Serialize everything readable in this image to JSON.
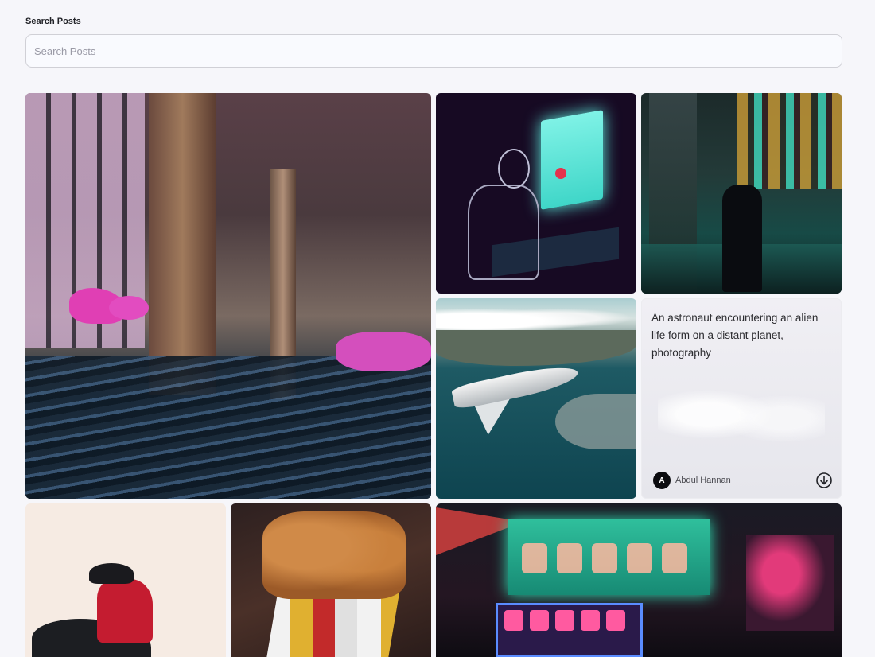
{
  "search": {
    "label": "Search Posts",
    "placeholder": "Search Posts",
    "value": ""
  },
  "gallery": {
    "posts": [
      {
        "subject": "pool interior with pink chairs"
      },
      {
        "subject": "figure at glowing computer"
      },
      {
        "subject": "rainy neon street"
      },
      {
        "subject": "space shuttle over coast"
      },
      {
        "prompt": "An astronaut encountering an alien life form on a distant planet, photography",
        "author_initial": "A",
        "author": "Abdul Hannan",
        "action_icon": "download-icon"
      },
      {
        "subject": "samurai on horse"
      },
      {
        "subject": "bread rubik cube"
      },
      {
        "subject": "neon city signs"
      }
    ]
  },
  "colors": {
    "background": "#f6f6fa",
    "text": "#222328",
    "avatar": "#0b0b0f"
  }
}
